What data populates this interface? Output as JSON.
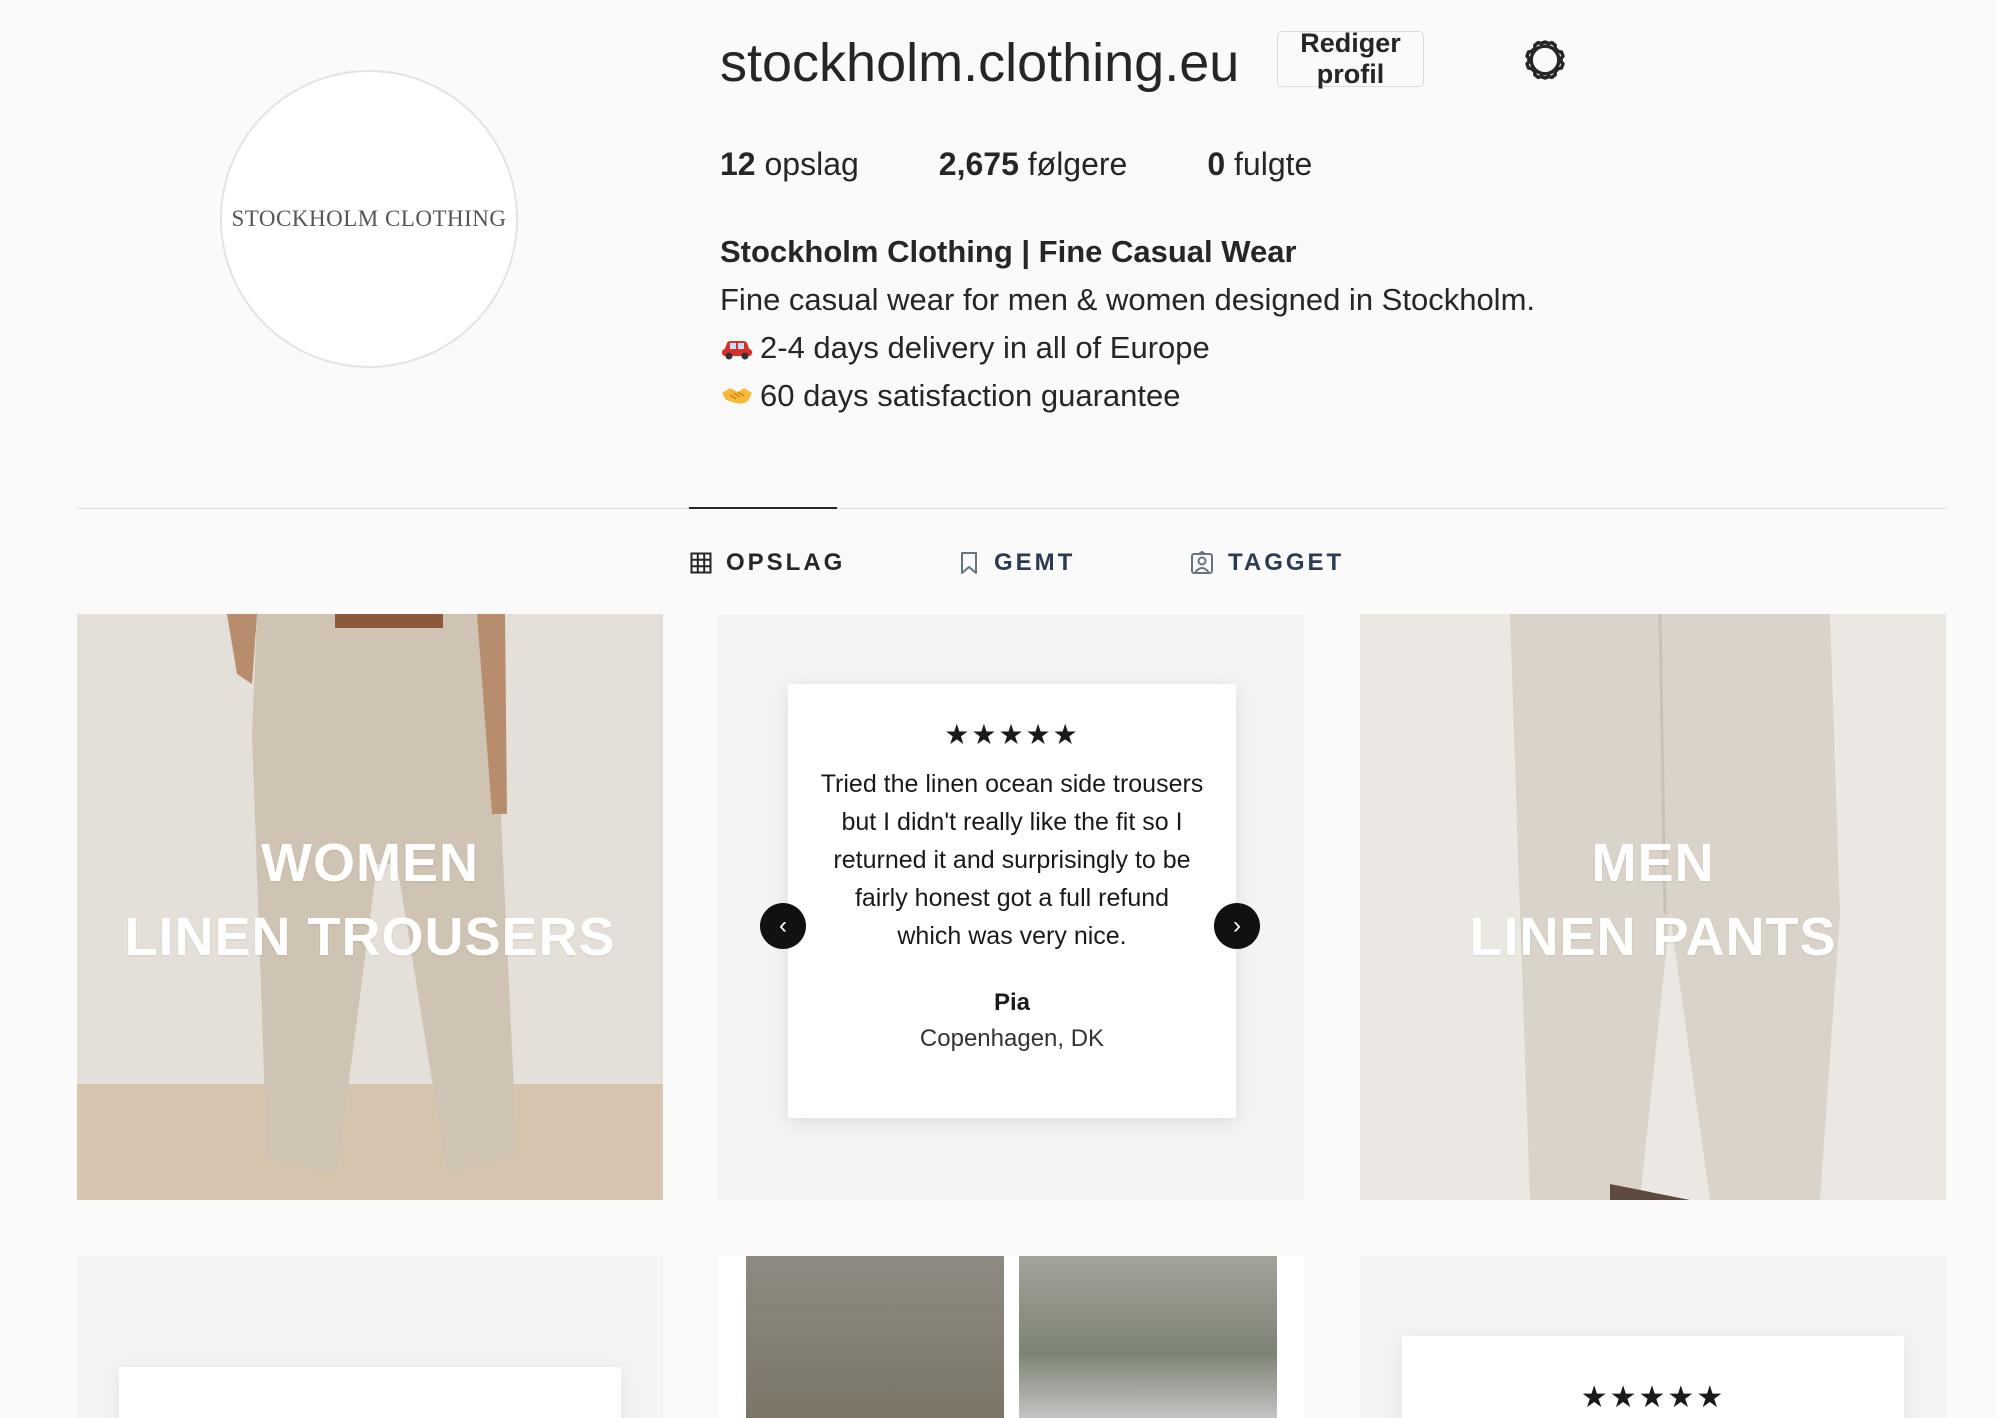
{
  "profile": {
    "username": "stockholm.clothing.eu",
    "edit_button": "Rediger profil",
    "avatar_text": "STOCKHOLM CLOTHING",
    "stats": {
      "posts_count": "12",
      "posts_label": "opslag",
      "followers_count": "2,675",
      "followers_label": "følgere",
      "following_count": "0",
      "following_label": "fulgte"
    },
    "bio": {
      "name": "Stockholm Clothing | Fine Casual Wear",
      "line1": "Fine casual wear for men & women designed in Stockholm.",
      "line2": "2-4 days delivery in all of Europe",
      "line3": "60 days satisfaction guarantee"
    }
  },
  "tabs": {
    "posts": "OPSLAG",
    "saved": "GEMT",
    "tagged": "TAGGET"
  },
  "posts": {
    "tile1": {
      "line1": "WOMEN",
      "line2": "LINEN TROUSERS"
    },
    "tile2": {
      "stars": "★★★★★",
      "review_line1": "Tried the linen ocean side trousers",
      "review_line2": "but I didn't really like the fit so I",
      "review_line3": "returned it and surprisingly to be",
      "review_line4": "fairly honest got a full refund",
      "review_line5": "which was very nice.",
      "author": "Pia",
      "location": "Copenhagen, DK"
    },
    "tile3": {
      "line1": "MEN",
      "line2": "LINEN PANTS"
    },
    "tile6": {
      "stars": "★★★★★"
    }
  },
  "icons": {
    "settings": "gear-icon",
    "car": "car-icon",
    "handshake": "handshake-icon",
    "grid": "grid-icon",
    "bookmark": "bookmark-icon",
    "tag": "tag-icon"
  }
}
